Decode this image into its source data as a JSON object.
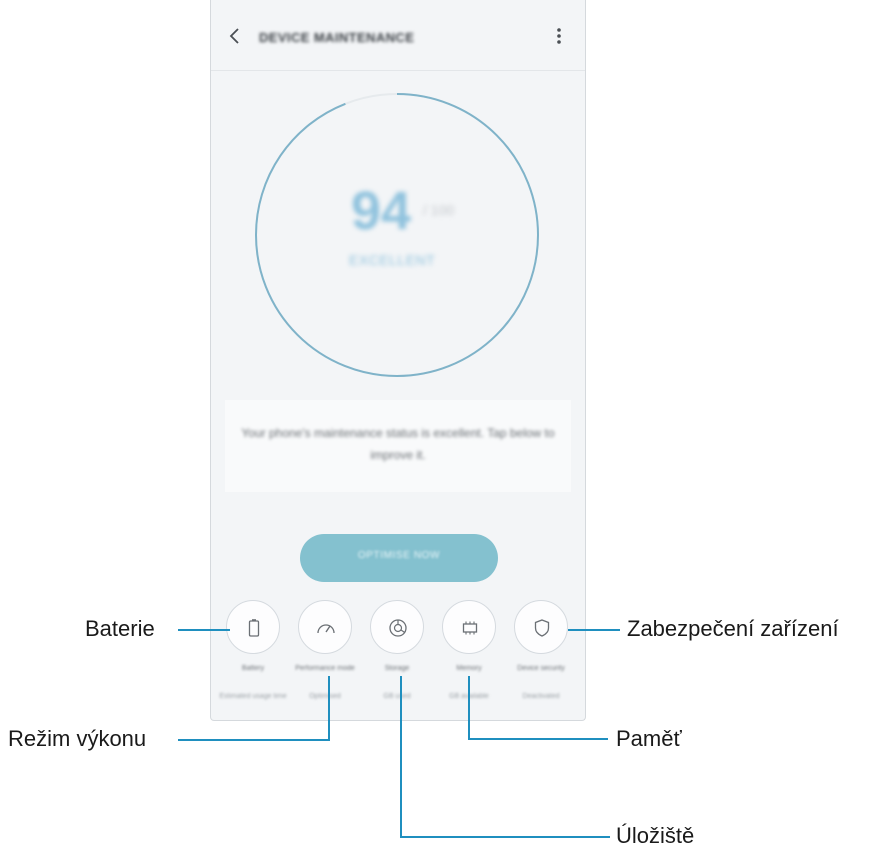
{
  "app": {
    "title": "DEVICE MAINTENANCE"
  },
  "score": {
    "value": "94",
    "max": "/ 100",
    "status": "EXCELLENT"
  },
  "message": "Your phone's maintenance status is excellent. Tap below to improve it.",
  "optimize_label": "OPTIMISE NOW",
  "tools": [
    {
      "label": "Battery",
      "sub": "Estimated usage time",
      "icon": "battery-icon"
    },
    {
      "label": "Performance mode",
      "sub": "Optimised",
      "icon": "speedometer-icon"
    },
    {
      "label": "Storage",
      "sub": "GB used",
      "icon": "pie-chart-icon"
    },
    {
      "label": "Memory",
      "sub": "GB available",
      "icon": "memory-chip-icon"
    },
    {
      "label": "Device security",
      "sub": "Deactivated",
      "icon": "shield-icon"
    }
  ],
  "callouts": {
    "baterie": "Baterie",
    "rezim": "Režim výkonu",
    "uloziste": "Úložiště",
    "pamet": "Paměť",
    "zabezpeceni": "Zabezpečení zařízení"
  },
  "colors": {
    "accent": "#84c1cf",
    "ring": "#7fb3c9",
    "callout_line": "#1f8fbf"
  }
}
